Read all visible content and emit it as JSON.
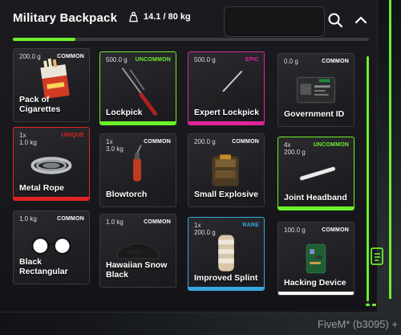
{
  "header": {
    "title": "Military Backpack",
    "weight_text": "14.1 / 80 kg",
    "weight_fraction": 0.176,
    "search_value": ""
  },
  "colors": {
    "accent": "#6cf02a",
    "common": "#ffffff",
    "uncommon": "#6cf02a",
    "epic": "#e0259a",
    "unique": "#e02424",
    "rare": "#37a7e0"
  },
  "items": [
    {
      "top": "200.0 g",
      "qty": "",
      "rarity": "COMMON",
      "name": "Pack of Cigarettes",
      "rarity_key": "common",
      "icon": "cigarettes-icon"
    },
    {
      "top": "500.0 g",
      "qty": "",
      "rarity": "UNCOMMON",
      "name": "Lockpick",
      "rarity_key": "uncommon",
      "icon": "lockpick-icon"
    },
    {
      "top": "500.0 g",
      "qty": "",
      "rarity": "EPIC",
      "name": "Expert Lockpick",
      "rarity_key": "epic",
      "icon": "expert-lockpick-icon"
    },
    {
      "top": "0.0 g",
      "qty": "",
      "rarity": "COMMON",
      "name": "Government ID",
      "rarity_key": "common",
      "icon": "id-card-icon"
    },
    {
      "top": "1.0 kg",
      "qty": "1x",
      "rarity": "UNIQUE",
      "name": "Metal Rope",
      "rarity_key": "unique",
      "icon": "rope-icon"
    },
    {
      "top": "3.0 kg",
      "qty": "1x",
      "rarity": "COMMON",
      "name": "Blowtorch",
      "rarity_key": "common",
      "icon": "blowtorch-icon"
    },
    {
      "top": "200.0 g",
      "qty": "",
      "rarity": "COMMON",
      "name": "Small Explosive",
      "rarity_key": "common",
      "icon": "explosive-icon"
    },
    {
      "top": "200.0 g",
      "qty": "4x",
      "rarity": "UNCOMMON",
      "name": "Joint Headband",
      "rarity_key": "uncommon",
      "icon": "headband-icon"
    },
    {
      "top": "1.0 kg",
      "qty": "",
      "rarity": "COMMON",
      "name": "Black Rectangular",
      "rarity_key": "common",
      "icon": "glasses-icon"
    },
    {
      "top": "1.0 kg",
      "qty": "",
      "rarity": "COMMON",
      "name": "Hawaiian Snow Black",
      "rarity_key": "common",
      "icon": "cap-icon"
    },
    {
      "top": "200.0 g",
      "qty": "1x",
      "rarity": "RARE",
      "name": "Improved Splint",
      "rarity_key": "rare",
      "icon": "splint-icon"
    },
    {
      "top": "100.0 g",
      "qty": "",
      "rarity": "COMMON",
      "name": "Hacking Device",
      "rarity_key": "common",
      "icon": "hacking-device-icon"
    }
  ],
  "watermark": "FiveM* (b3095) +"
}
